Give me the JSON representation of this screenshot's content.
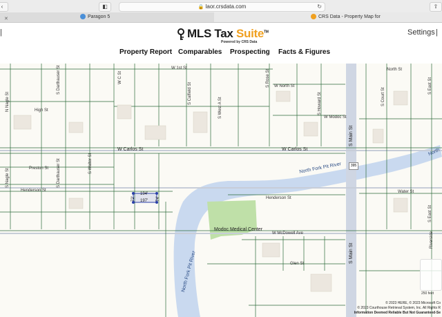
{
  "browser": {
    "url": "laor.crsdata.com",
    "tabs": [
      {
        "label": "Paragon 5"
      },
      {
        "label": "CRS Data - Property Map for"
      }
    ]
  },
  "app": {
    "brand": "MLS Tax Suite",
    "brand_main": "MLS Tax",
    "brand_accent": "Suite",
    "trademark": "TM",
    "powered_by": "Powered by CRS Data",
    "settings_label": "Settings",
    "nav": [
      "Property Report",
      "Comparables",
      "Prospecting",
      "Facts & Figures"
    ]
  },
  "map": {
    "streets": {
      "w1st": "W 1st St",
      "wnorth": "W North St",
      "north": "North St",
      "high": "High St",
      "wmodoc": "W Modoc St",
      "wcarlos_left": "W Carlos St",
      "wcarlos_right": "W Carlos St",
      "preston": "Preston St",
      "henderson_left": "Henderson St",
      "henderson_right": "Henderson St",
      "water": "Water St",
      "wmcdowell": "W McDowell Ave",
      "glen": "Glen St",
      "nagle": "N Nagle St",
      "sdarthauser_top": "S Darthauser St",
      "sdarthauser": "S Darthauser St",
      "scalifield": "S Calfield St",
      "swesta": "S West A St",
      "srose": "S Rose St",
      "showard": "S Howard St",
      "scourt": "S Court St",
      "seast_top": "S East St",
      "seast": "S East St",
      "smain_top": "S Main St",
      "smain": "S Main St",
      "swalter": "S Walter St",
      "nagle2": "S Nagle St",
      "riverside": "Riverside",
      "wc": "W C St"
    },
    "river_labels": [
      "North Fork Pit River",
      "North Fork Pit River",
      "North"
    ],
    "poi": "Modoc Medical Center",
    "highway": "395",
    "measure_labels": [
      "194'",
      "197'",
      "72'",
      "74'"
    ],
    "scale_label": "250 feet",
    "attribution": [
      "© 2023 HERE, © 2023 Microsoft Co",
      "© 2023 Courthouse Retrieval System, Inc. All Rights R",
      "Information Deemed Reliable But Not Guaranteed-Se"
    ]
  },
  "colors": {
    "parcel": "#2d6b3a",
    "river": "#c9d9ef",
    "road_major": "#cfd6e3",
    "park": "#bfe0a8",
    "accent": "#f0a020"
  }
}
